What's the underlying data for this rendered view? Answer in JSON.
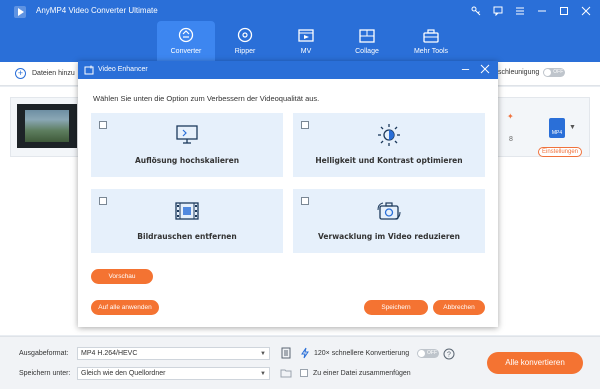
{
  "app": {
    "title": "AnyMP4 Video Converter Ultimate",
    "accent_color": "#2a6fd8",
    "action_color": "#f47332"
  },
  "tabs": [
    {
      "label": "Converter",
      "icon": "convert-icon",
      "active": true
    },
    {
      "label": "Ripper",
      "icon": "disc-icon",
      "active": false
    },
    {
      "label": "MV",
      "icon": "mv-icon",
      "active": false
    },
    {
      "label": "Collage",
      "icon": "collage-icon",
      "active": false
    },
    {
      "label": "Mehr Tools",
      "icon": "toolbox-icon",
      "active": false
    }
  ],
  "toolbar": {
    "add_files_label": "Dateien hinzu",
    "acceleration_label": "schleunigung",
    "acceleration_toggle": "OFF"
  },
  "file_row": {
    "format_badge": "MP4",
    "settings_label": "Einstellungen",
    "partial_number": "8"
  },
  "dialog": {
    "title": "Video Enhancer",
    "instruction": "Wählen Sie unten die Option zum Verbessern der Videoqualität aus.",
    "options": [
      {
        "label": "Auflösung hochskalieren",
        "icon": "monitor-icon",
        "checked": false
      },
      {
        "label": "Helligkeit und Kontrast optimieren",
        "icon": "brightness-icon",
        "checked": false
      },
      {
        "label": "Bildrauschen entfernen",
        "icon": "film-icon",
        "checked": false
      },
      {
        "label": "Verwacklung im Video reduzieren",
        "icon": "camera-stabilize-icon",
        "checked": false
      }
    ],
    "preview_label": "Vorschau",
    "apply_all_label": "Auf alle anwenden",
    "save_label": "Speichern",
    "cancel_label": "Abbrechen"
  },
  "bottom": {
    "output_format_label": "Ausgabeformat:",
    "output_format_value": "MP4 H.264/HEVC",
    "speed_text": "120× schnellere Konvertierung",
    "speed_toggle": "OFF",
    "save_to_label": "Speichern unter:",
    "save_to_value": "Gleich wie den Quellordner",
    "merge_label": "Zu einer Datei zusammenfügen",
    "convert_all_label": "Alle konvertieren"
  }
}
